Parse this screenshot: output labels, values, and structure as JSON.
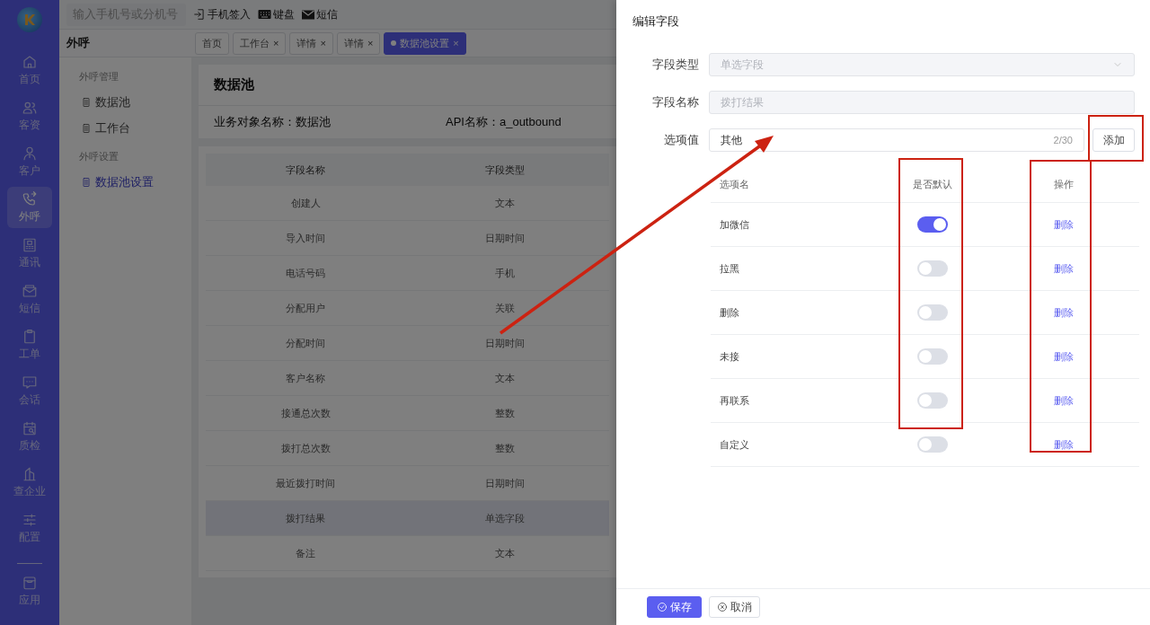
{
  "rail": {
    "items": [
      {
        "label": "首页",
        "selected": false
      },
      {
        "label": "客资",
        "selected": false
      },
      {
        "label": "客户",
        "selected": false
      },
      {
        "label": "外呼",
        "selected": true
      },
      {
        "label": "通讯",
        "selected": false
      },
      {
        "label": "短信",
        "selected": false
      },
      {
        "label": "工单",
        "selected": false
      },
      {
        "label": "会话",
        "selected": false
      },
      {
        "label": "质检",
        "selected": false
      },
      {
        "label": "查企业",
        "selected": false
      },
      {
        "label": "配置",
        "selected": false
      }
    ],
    "bottom_items": [
      {
        "label": "应用",
        "selected": false
      }
    ]
  },
  "topbar": {
    "search": {
      "placeholder": "输入手机号或分机号"
    },
    "actions": [
      "手机签入",
      "键盘",
      "短信"
    ]
  },
  "section_title": "外呼",
  "tabs": [
    {
      "label": "首页",
      "selected": false
    },
    {
      "label": "工作台",
      "close": "×",
      "selected": false
    },
    {
      "label": "详情",
      "close": "×",
      "selected": false
    },
    {
      "label": "详情",
      "close": "×",
      "selected": false
    },
    {
      "label": "数据池设置",
      "close": "×",
      "selected": true
    }
  ],
  "subnav": [
    {
      "title": "外呼管理",
      "items": [
        {
          "label": "数据池",
          "selected": false
        },
        {
          "label": "工作台",
          "selected": false
        }
      ]
    },
    {
      "title": "外呼设置",
      "items": [
        {
          "label": "数据池设置",
          "selected": true
        }
      ]
    }
  ],
  "object": {
    "title": "数据池",
    "info": [
      "业务对象名称：数据池",
      "API名称：a_outbound"
    ]
  },
  "table": {
    "columns": [
      "字段名称",
      "字段类型"
    ],
    "rows": [
      {
        "cells": [
          "创建人",
          "文本"
        ],
        "selected": false
      },
      {
        "cells": [
          "导入时间",
          "日期时间"
        ],
        "selected": false
      },
      {
        "cells": [
          "电话号码",
          "手机"
        ],
        "selected": false
      },
      {
        "cells": [
          "分配用户",
          "关联"
        ],
        "selected": false
      },
      {
        "cells": [
          "分配时间",
          "日期时间"
        ],
        "selected": false
      },
      {
        "cells": [
          "客户名称",
          "文本"
        ],
        "selected": false
      },
      {
        "cells": [
          "接通总次数",
          "整数"
        ],
        "selected": false
      },
      {
        "cells": [
          "拨打总次数",
          "整数"
        ],
        "selected": false
      },
      {
        "cells": [
          "最近拨打时间",
          "日期时间"
        ],
        "selected": false
      },
      {
        "cells": [
          "拨打结果",
          "单选字段"
        ],
        "selected": true
      },
      {
        "cells": [
          "备注",
          "文本"
        ],
        "selected": false
      }
    ]
  },
  "drawer": {
    "title": "编辑字段",
    "fields": [
      {
        "kind": "select",
        "label": "字段类型",
        "value": "单选字段",
        "disabled": true
      },
      {
        "kind": "text",
        "label": "字段名称",
        "value": "拨打结果",
        "disabled": true
      },
      {
        "kind": "option-input",
        "label": "选项值",
        "value": "其他",
        "counter": "2/30",
        "button": "添加",
        "disabled": false
      }
    ],
    "options_table": {
      "columns": [
        "选项名",
        "是否默认",
        "操作"
      ],
      "rows": [
        {
          "name": "加微信",
          "default": true,
          "action": "删除"
        },
        {
          "name": "拉黑",
          "default": false,
          "action": "删除"
        },
        {
          "name": "删除",
          "default": false,
          "action": "删除"
        },
        {
          "name": "未接",
          "default": false,
          "action": "删除"
        },
        {
          "name": "再联系",
          "default": false,
          "action": "删除"
        },
        {
          "name": "自定义",
          "default": false,
          "action": "删除"
        }
      ]
    },
    "footer_buttons": [
      {
        "label": "保存",
        "kind": "primary"
      },
      {
        "label": "取消",
        "kind": "default"
      }
    ]
  }
}
